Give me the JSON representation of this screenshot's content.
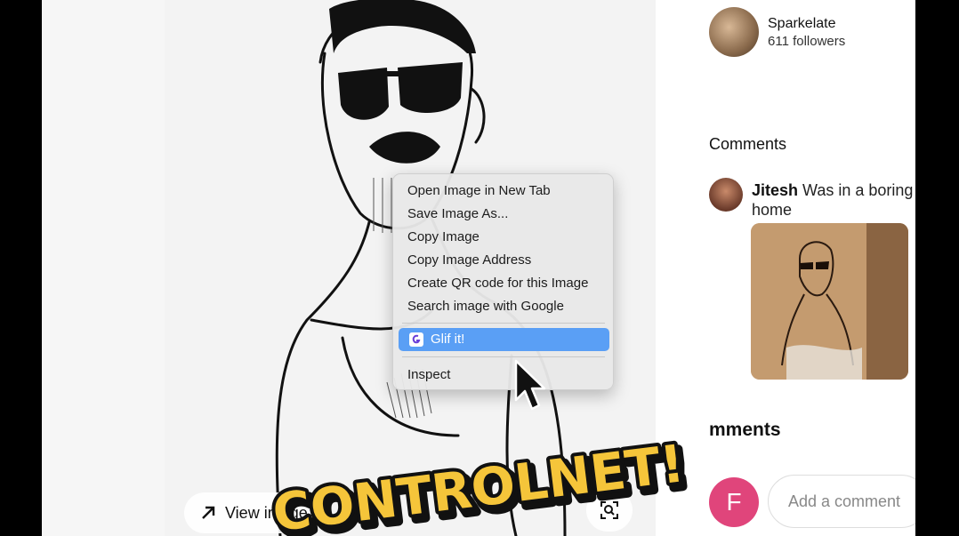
{
  "author": {
    "name": "Sparkelate",
    "followers": "611 followers"
  },
  "comments": {
    "title": "Comments",
    "items": [
      {
        "user": "Jitesh",
        "text": "Was in a boring",
        "text_line2": "home"
      }
    ],
    "count_heading_suffix": "mments"
  },
  "composer": {
    "avatar_letter": "F",
    "placeholder": "Add a comment"
  },
  "image_actions": {
    "view_image": "View image"
  },
  "context_menu": {
    "items": [
      "Open Image in New Tab",
      "Save Image As...",
      "Copy Image",
      "Copy Image Address",
      "Create QR code for this Image",
      "Search image with Google"
    ],
    "extension_item": "Glif it!",
    "inspect": "Inspect",
    "highlight_color": "#5a9ff5"
  },
  "overlay": {
    "text": "CONTROLNET!",
    "fill": "#f5c53a"
  },
  "icons": [
    "arrow-up-right-icon",
    "visual-search-icon",
    "glif-icon",
    "mouse-cursor-icon"
  ]
}
